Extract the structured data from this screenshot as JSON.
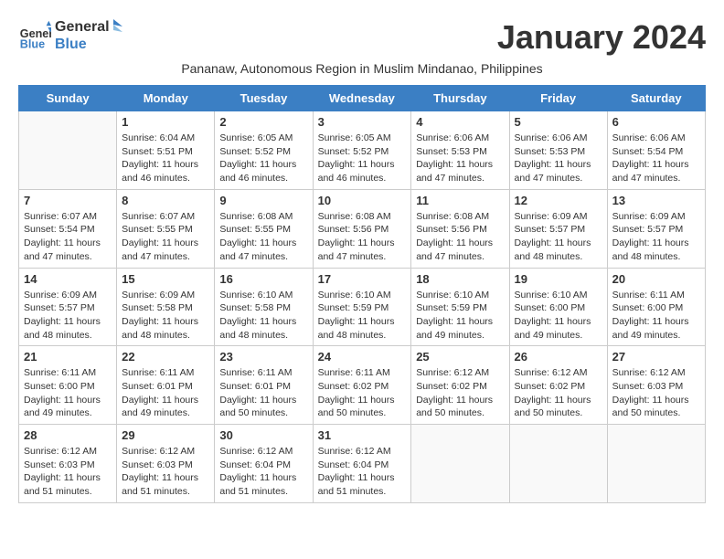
{
  "header": {
    "logo_general": "General",
    "logo_blue": "Blue",
    "month_title": "January 2024",
    "subtitle": "Pananaw, Autonomous Region in Muslim Mindanao, Philippines"
  },
  "weekdays": [
    "Sunday",
    "Monday",
    "Tuesday",
    "Wednesday",
    "Thursday",
    "Friday",
    "Saturday"
  ],
  "weeks": [
    [
      {
        "day": "",
        "sunrise": "",
        "sunset": "",
        "daylight": ""
      },
      {
        "day": "1",
        "sunrise": "Sunrise: 6:04 AM",
        "sunset": "Sunset: 5:51 PM",
        "daylight": "Daylight: 11 hours and 46 minutes."
      },
      {
        "day": "2",
        "sunrise": "Sunrise: 6:05 AM",
        "sunset": "Sunset: 5:52 PM",
        "daylight": "Daylight: 11 hours and 46 minutes."
      },
      {
        "day": "3",
        "sunrise": "Sunrise: 6:05 AM",
        "sunset": "Sunset: 5:52 PM",
        "daylight": "Daylight: 11 hours and 46 minutes."
      },
      {
        "day": "4",
        "sunrise": "Sunrise: 6:06 AM",
        "sunset": "Sunset: 5:53 PM",
        "daylight": "Daylight: 11 hours and 47 minutes."
      },
      {
        "day": "5",
        "sunrise": "Sunrise: 6:06 AM",
        "sunset": "Sunset: 5:53 PM",
        "daylight": "Daylight: 11 hours and 47 minutes."
      },
      {
        "day": "6",
        "sunrise": "Sunrise: 6:06 AM",
        "sunset": "Sunset: 5:54 PM",
        "daylight": "Daylight: 11 hours and 47 minutes."
      }
    ],
    [
      {
        "day": "7",
        "sunrise": "Sunrise: 6:07 AM",
        "sunset": "Sunset: 5:54 PM",
        "daylight": "Daylight: 11 hours and 47 minutes."
      },
      {
        "day": "8",
        "sunrise": "Sunrise: 6:07 AM",
        "sunset": "Sunset: 5:55 PM",
        "daylight": "Daylight: 11 hours and 47 minutes."
      },
      {
        "day": "9",
        "sunrise": "Sunrise: 6:08 AM",
        "sunset": "Sunset: 5:55 PM",
        "daylight": "Daylight: 11 hours and 47 minutes."
      },
      {
        "day": "10",
        "sunrise": "Sunrise: 6:08 AM",
        "sunset": "Sunset: 5:56 PM",
        "daylight": "Daylight: 11 hours and 47 minutes."
      },
      {
        "day": "11",
        "sunrise": "Sunrise: 6:08 AM",
        "sunset": "Sunset: 5:56 PM",
        "daylight": "Daylight: 11 hours and 47 minutes."
      },
      {
        "day": "12",
        "sunrise": "Sunrise: 6:09 AM",
        "sunset": "Sunset: 5:57 PM",
        "daylight": "Daylight: 11 hours and 48 minutes."
      },
      {
        "day": "13",
        "sunrise": "Sunrise: 6:09 AM",
        "sunset": "Sunset: 5:57 PM",
        "daylight": "Daylight: 11 hours and 48 minutes."
      }
    ],
    [
      {
        "day": "14",
        "sunrise": "Sunrise: 6:09 AM",
        "sunset": "Sunset: 5:57 PM",
        "daylight": "Daylight: 11 hours and 48 minutes."
      },
      {
        "day": "15",
        "sunrise": "Sunrise: 6:09 AM",
        "sunset": "Sunset: 5:58 PM",
        "daylight": "Daylight: 11 hours and 48 minutes."
      },
      {
        "day": "16",
        "sunrise": "Sunrise: 6:10 AM",
        "sunset": "Sunset: 5:58 PM",
        "daylight": "Daylight: 11 hours and 48 minutes."
      },
      {
        "day": "17",
        "sunrise": "Sunrise: 6:10 AM",
        "sunset": "Sunset: 5:59 PM",
        "daylight": "Daylight: 11 hours and 48 minutes."
      },
      {
        "day": "18",
        "sunrise": "Sunrise: 6:10 AM",
        "sunset": "Sunset: 5:59 PM",
        "daylight": "Daylight: 11 hours and 49 minutes."
      },
      {
        "day": "19",
        "sunrise": "Sunrise: 6:10 AM",
        "sunset": "Sunset: 6:00 PM",
        "daylight": "Daylight: 11 hours and 49 minutes."
      },
      {
        "day": "20",
        "sunrise": "Sunrise: 6:11 AM",
        "sunset": "Sunset: 6:00 PM",
        "daylight": "Daylight: 11 hours and 49 minutes."
      }
    ],
    [
      {
        "day": "21",
        "sunrise": "Sunrise: 6:11 AM",
        "sunset": "Sunset: 6:00 PM",
        "daylight": "Daylight: 11 hours and 49 minutes."
      },
      {
        "day": "22",
        "sunrise": "Sunrise: 6:11 AM",
        "sunset": "Sunset: 6:01 PM",
        "daylight": "Daylight: 11 hours and 49 minutes."
      },
      {
        "day": "23",
        "sunrise": "Sunrise: 6:11 AM",
        "sunset": "Sunset: 6:01 PM",
        "daylight": "Daylight: 11 hours and 50 minutes."
      },
      {
        "day": "24",
        "sunrise": "Sunrise: 6:11 AM",
        "sunset": "Sunset: 6:02 PM",
        "daylight": "Daylight: 11 hours and 50 minutes."
      },
      {
        "day": "25",
        "sunrise": "Sunrise: 6:12 AM",
        "sunset": "Sunset: 6:02 PM",
        "daylight": "Daylight: 11 hours and 50 minutes."
      },
      {
        "day": "26",
        "sunrise": "Sunrise: 6:12 AM",
        "sunset": "Sunset: 6:02 PM",
        "daylight": "Daylight: 11 hours and 50 minutes."
      },
      {
        "day": "27",
        "sunrise": "Sunrise: 6:12 AM",
        "sunset": "Sunset: 6:03 PM",
        "daylight": "Daylight: 11 hours and 50 minutes."
      }
    ],
    [
      {
        "day": "28",
        "sunrise": "Sunrise: 6:12 AM",
        "sunset": "Sunset: 6:03 PM",
        "daylight": "Daylight: 11 hours and 51 minutes."
      },
      {
        "day": "29",
        "sunrise": "Sunrise: 6:12 AM",
        "sunset": "Sunset: 6:03 PM",
        "daylight": "Daylight: 11 hours and 51 minutes."
      },
      {
        "day": "30",
        "sunrise": "Sunrise: 6:12 AM",
        "sunset": "Sunset: 6:04 PM",
        "daylight": "Daylight: 11 hours and 51 minutes."
      },
      {
        "day": "31",
        "sunrise": "Sunrise: 6:12 AM",
        "sunset": "Sunset: 6:04 PM",
        "daylight": "Daylight: 11 hours and 51 minutes."
      },
      {
        "day": "",
        "sunrise": "",
        "sunset": "",
        "daylight": ""
      },
      {
        "day": "",
        "sunrise": "",
        "sunset": "",
        "daylight": ""
      },
      {
        "day": "",
        "sunrise": "",
        "sunset": "",
        "daylight": ""
      }
    ]
  ]
}
